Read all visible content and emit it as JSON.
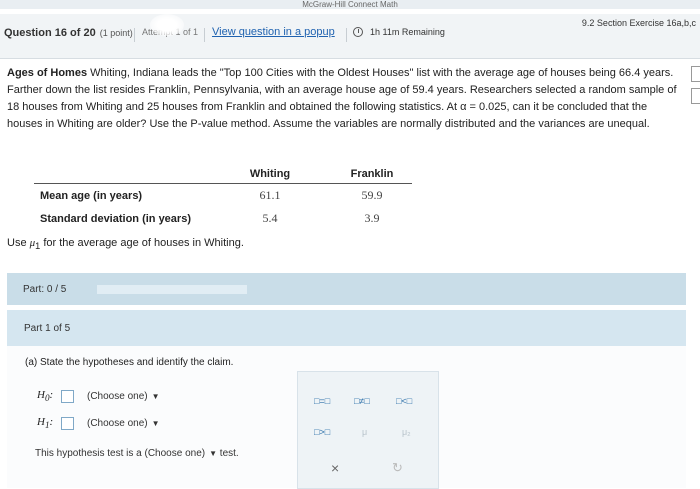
{
  "header": {
    "brand": "McGraw-Hill Connect Math",
    "question_label": "Question 16 of 20",
    "points": "(1 point)",
    "attempt": "Attempt 1 of 1",
    "view_popup": "View question in a popup",
    "time_remaining": "1h 11m Remaining",
    "section": "9.2 Section Exercise 16a,b,c"
  },
  "problem": {
    "title": "Ages of Homes",
    "text": "Whiting, Indiana leads the \"Top 100 Cities with the Oldest Houses\" list with the average age of houses being 66.4 years. Farther down the list resides Franklin, Pennsylvania, with an average house age of 59.4 years. Researchers selected a random sample of 18 houses from Whiting and 25 houses from Franklin and obtained the following statistics. At α = 0.025, can it be concluded that the houses in Whiting are older? Use the P-value method. Assume the variables are normally distributed and the variances are unequal."
  },
  "table": {
    "headers": [
      "",
      "Whiting",
      "Franklin"
    ],
    "rows": [
      {
        "label": "Mean age (in years)",
        "whiting": "61.1",
        "franklin": "59.9"
      },
      {
        "label": "Standard deviation (in years)",
        "whiting": "5.4",
        "franklin": "3.9"
      }
    ]
  },
  "use_mu": {
    "prefix": "Use",
    "symbol": "μ",
    "sub": "1",
    "suffix": "for the average age of houses in Whiting."
  },
  "part_progress": {
    "label": "Part: 0 / 5",
    "progress": 0
  },
  "part_section": {
    "label": "Part 1 of 5"
  },
  "part_a": {
    "statement": "(a) State the hypotheses and identify the claim.",
    "h0_label": "H",
    "h0_sub": "0",
    "h1_label": "H",
    "h1_sub": "1",
    "choose": "(Choose one)",
    "test_prefix": "This hypothesis test is a",
    "test_choose": "(Choose one)",
    "test_suffix": "test."
  },
  "palette": {
    "eq": "□=□",
    "neq": "□≠□",
    "lt": "□<□",
    "gt": "□>□",
    "mu": "μ",
    "mu2": "μ₂",
    "clear": "×",
    "redo": "↻"
  },
  "colors": {
    "link": "#1f62b0",
    "part_bar": "#c9dde8",
    "part_section": "#d5e6f0"
  }
}
